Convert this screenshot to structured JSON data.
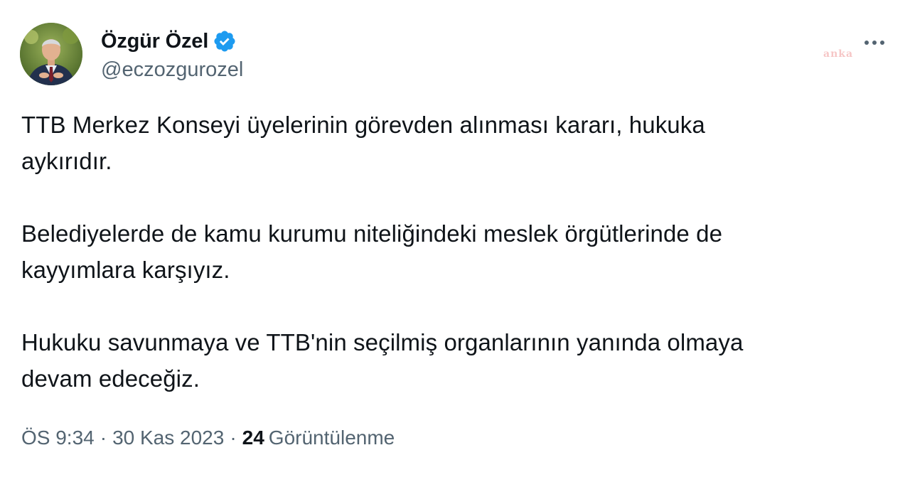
{
  "author": {
    "display_name": "Özgür Özel",
    "handle": "@eczozgurozel",
    "verified": true,
    "avatar_icon": "user-avatar-photo"
  },
  "watermark": "anka",
  "tweet": {
    "paragraphs": [
      {
        "line1": "TTB Merkez Konseyi üyelerinin görevden alınması kararı, hukuka",
        "line2": "aykırıdır."
      },
      {
        "line1": "Belediyelerde de kamu kurumu niteliğindeki meslek örgütlerinde de",
        "line2": "kayyımlara karşıyız."
      },
      {
        "line1": "Hukuku savunmaya ve TTB'nin seçilmiş organlarının yanında olmaya",
        "line2": "devam edeceğiz."
      }
    ]
  },
  "meta": {
    "time": "ÖS 9:34",
    "separator": "·",
    "date": "30 Kas 2023",
    "views_count": "24",
    "views_label": "Görüntülenme"
  },
  "colors": {
    "text_primary": "#0f1419",
    "text_secondary": "#536471",
    "verified_blue": "#1d9bf0",
    "watermark": "#f3b3b3"
  }
}
